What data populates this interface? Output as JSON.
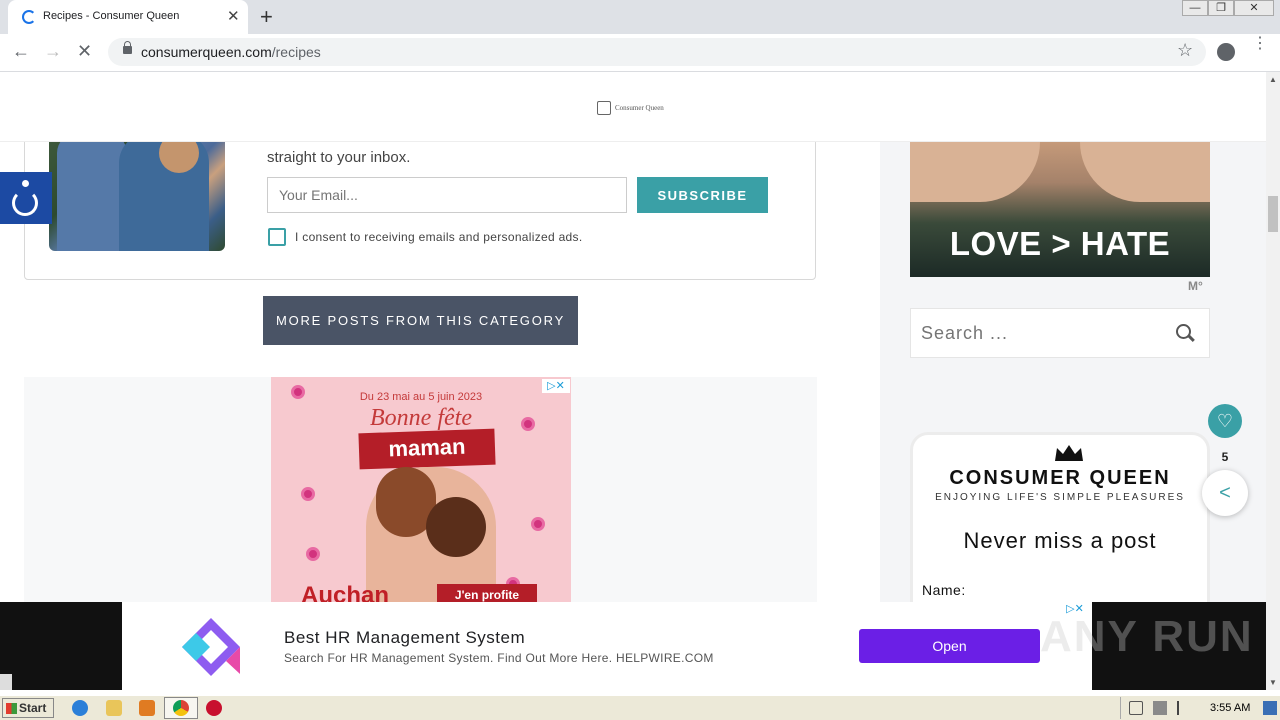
{
  "browser": {
    "tab_title": "Recipes - Consumer Queen",
    "url_host": "consumerqueen.com",
    "url_path": "/recipes",
    "window_min": "—",
    "window_max": "❐",
    "window_close": "✕",
    "tab_close": "✕",
    "new_tab": "+"
  },
  "site": {
    "logo_text": "Consumer Queen"
  },
  "optin": {
    "text": "straight to your inbox.",
    "email_placeholder": "Your Email...",
    "subscribe_label": "SUBSCRIBE",
    "consent_label": "I consent to receiving emails and personalized ads."
  },
  "more_posts_label": "MORE POSTS FROM THIS CATEGORY",
  "ad_banner": {
    "date": "Du 23 mai au 5 juin 2023",
    "script": "Bonne fête",
    "headline": "maman",
    "brand": "Auchan",
    "cta": "J'en profite",
    "choices": "▷✕"
  },
  "sidebar": {
    "love_ad_text": "LOVE > HATE",
    "ad_mark": "M°",
    "search_placeholder": "Search ...",
    "card": {
      "title": "CONSUMER QUEEN",
      "tagline": "ENJOYING LIFE'S SIMPLE PLEASURES",
      "never_miss": "Never miss a post",
      "name_label": "Name:"
    }
  },
  "floating": {
    "fav_icon": "♡",
    "share_count": "5",
    "share_icon": "<"
  },
  "bottom_ad": {
    "title": "Best HR Management System",
    "description": "Search For HR Management System. Find Out More Here. HELPWIRE.COM",
    "open_label": "Open",
    "choices": "▷✕",
    "watermark": "ANY RUN"
  },
  "taskbar": {
    "start_label": "Start",
    "clock": "3:55 AM"
  },
  "colors": {
    "accent_teal": "#3aa0a6",
    "button_slate": "#4a5466",
    "open_purple": "#6b1fe6",
    "accessibility_blue": "#1c4aa3"
  }
}
